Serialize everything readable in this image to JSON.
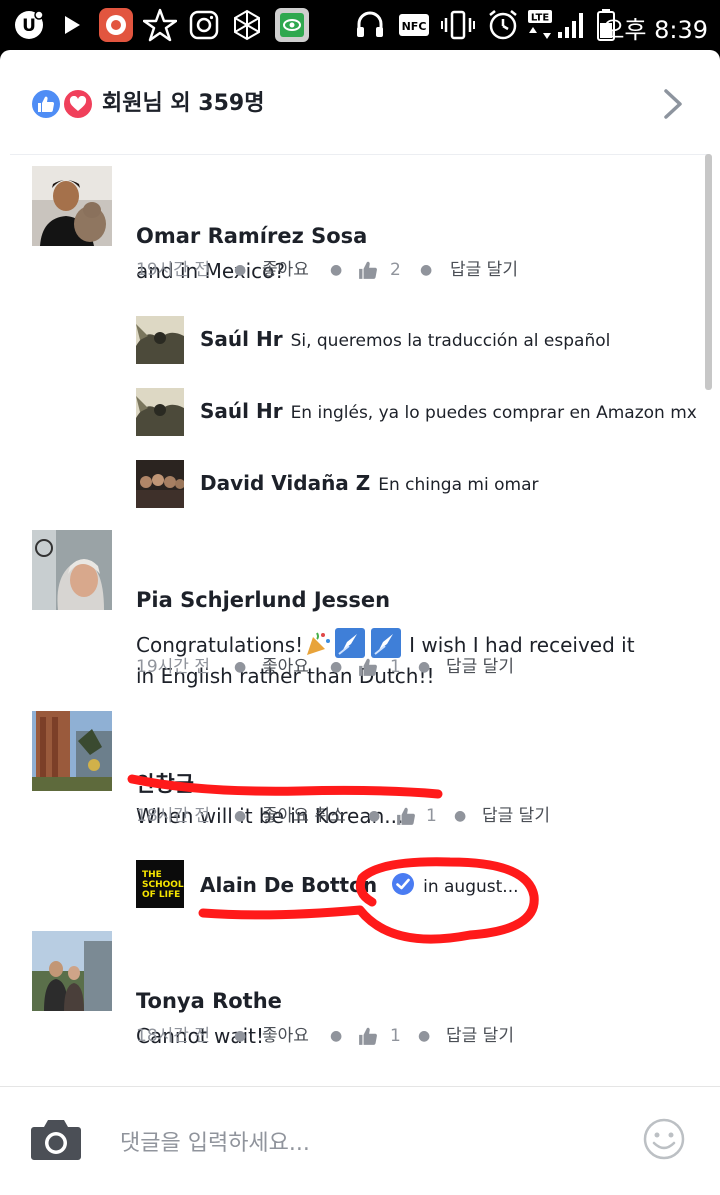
{
  "status_bar": {
    "time": "오후 8:39",
    "nfc_label": "NFC",
    "lte_label": "LTE",
    "icons": [
      "u-app-icon",
      "play-icon",
      "record-icon",
      "star-icon",
      "instagram-icon",
      "snowflake-icon",
      "eye-app-icon",
      "headset-icon",
      "nfc-icon",
      "vibrate-icon",
      "alarm-icon",
      "lte-icon",
      "signal-icon",
      "battery-icon"
    ]
  },
  "reactions": {
    "summary": "회원님 외 359명",
    "types": [
      "like",
      "love"
    ]
  },
  "comments": [
    {
      "author": "Omar Ramírez Sosa",
      "text": "and in Mexico?",
      "time": "19시간 전",
      "like_label": "좋아요",
      "like_count": "2",
      "reply_label": "답글 달기",
      "replies": [
        {
          "author": "Saúl Hr",
          "text": "Si, queremos la traducción al español"
        },
        {
          "author": "Saúl Hr",
          "text": "En inglés, ya lo puedes comprar en Amazon mx"
        },
        {
          "author": "David Vidaña Z",
          "text": "En chinga mi omar"
        }
      ]
    },
    {
      "author": "Pia Schjerlund Jessen",
      "text_line1_a": "Congratulations!",
      "text_line1_b": "I wish I had received it",
      "text_line2": "in English rather than Dutch!!",
      "time": "19시간 전",
      "like_label": "좋아요",
      "like_count": "1",
      "reply_label": "답글 달기"
    },
    {
      "author": "안창균",
      "text": "When will it be in Korean...",
      "time": "18시간 전",
      "like_label": "좋아요 취소",
      "like_count": "1",
      "reply_label": "답글 달기",
      "replies": [
        {
          "author": "Alain De Botton",
          "verified": true,
          "text": "in august...",
          "avatar_text": "THE SCHOOL OF LIFE"
        }
      ]
    },
    {
      "author": "Tonya Rothe",
      "text": "Cannot wait!",
      "time": "18시간 전",
      "like_label": "좋아요",
      "like_count": "1",
      "reply_label": "답글 달기"
    }
  ],
  "composer": {
    "placeholder": "댓글을 입력하세요..."
  },
  "colors": {
    "facebook_blue": "#4f8df5",
    "love_red": "#f0405b",
    "annotation_red": "#ff1a1a",
    "meta_gray": "#90949c",
    "school_of_life_yellow": "#f5e400"
  }
}
